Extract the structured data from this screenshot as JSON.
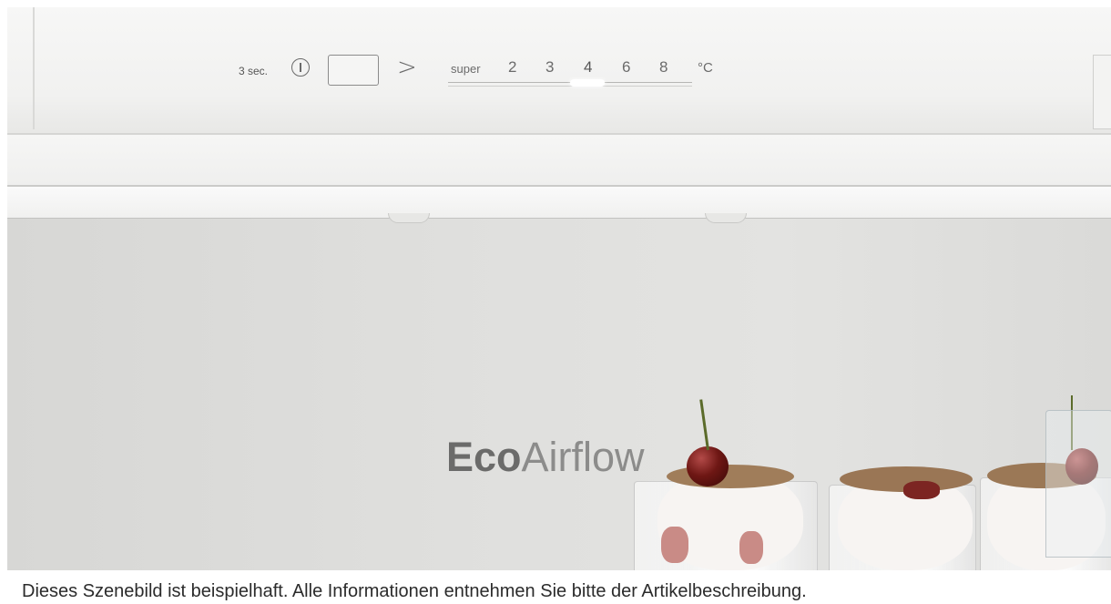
{
  "control_panel": {
    "hold_label": "3 sec.",
    "power_icon": "power-icon",
    "arrow": ">",
    "temperature_options": [
      "super",
      "2",
      "3",
      "4",
      "6",
      "8"
    ],
    "unit": "°C",
    "selected_temperature": "4"
  },
  "scene": {
    "brand_bold": "Eco",
    "brand_light": "Airflow"
  },
  "caption": "Dieses Szenebild ist beispielhaft. Alle Informationen entnehmen Sie bitte der Artikelbeschreibung.",
  "colors": {
    "panel": "#f3f3f2",
    "background": "#dedede",
    "caption_text": "#2b2b2b",
    "cherry": "#6e1714"
  }
}
